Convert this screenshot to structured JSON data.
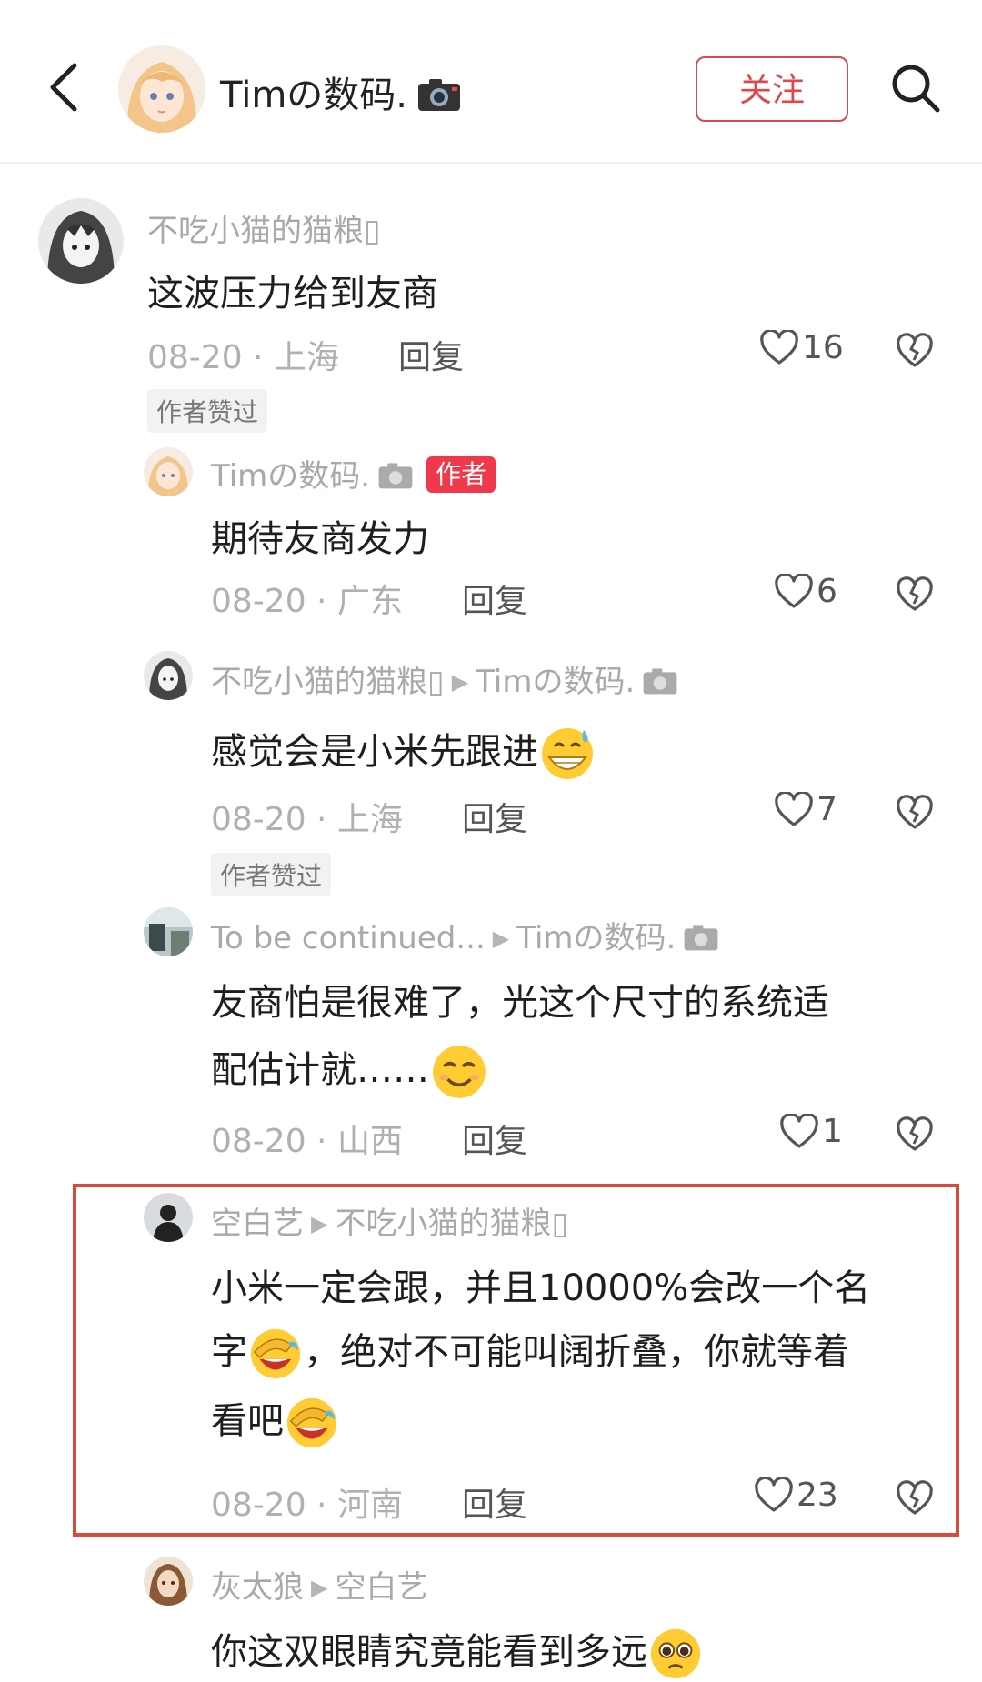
{
  "header": {
    "title": "Timの数码.",
    "follow_label": "关注"
  },
  "comments": [
    {
      "user": "不吃小猫的猫粮▯",
      "text": "这波压力给到友商",
      "date": "08-20",
      "location": "上海",
      "reply_label": "回复",
      "likes": "16",
      "tag": "作者赞过"
    },
    {
      "user": "Timの数码.",
      "author_badge": "作者",
      "text": "期待友商发力",
      "date": "08-20",
      "location": "广东",
      "reply_label": "回复",
      "likes": "6"
    },
    {
      "user": "不吃小猫的猫粮▯",
      "reply_to": "Timの数码.",
      "text": "感觉会是小米先跟进",
      "date": "08-20",
      "location": "上海",
      "reply_label": "回复",
      "likes": "7",
      "tag": "作者赞过"
    },
    {
      "user": "To  be  continued...",
      "reply_to": "Timの数码.",
      "text_lines": [
        "友商怕是很难了，光这个尺寸的系统适",
        "配估计就……"
      ],
      "date": "08-20",
      "location": "山西",
      "reply_label": "回复",
      "likes": "1"
    },
    {
      "user": "空白艺",
      "reply_to": "不吃小猫的猫粮▯",
      "text_lines": [
        "小米一定会跟，并且10000%会改一个名",
        "字",
        "，绝对不可能叫阔折叠，你就等着",
        "看吧"
      ],
      "date": "08-20",
      "location": "河南",
      "reply_label": "回复",
      "likes": "23"
    },
    {
      "user": "灰太狼",
      "reply_to": "空白艺",
      "text": "你这双眼睛究竟能看到多远"
    }
  ],
  "icons": [
    "back-arrow-icon",
    "search-icon",
    "camera-icon",
    "heart-icon",
    "broken-heart-icon"
  ],
  "colors": {
    "accent": "#e0464e",
    "highlight_border": "#d8493e",
    "muted": "#a9a9a9"
  }
}
